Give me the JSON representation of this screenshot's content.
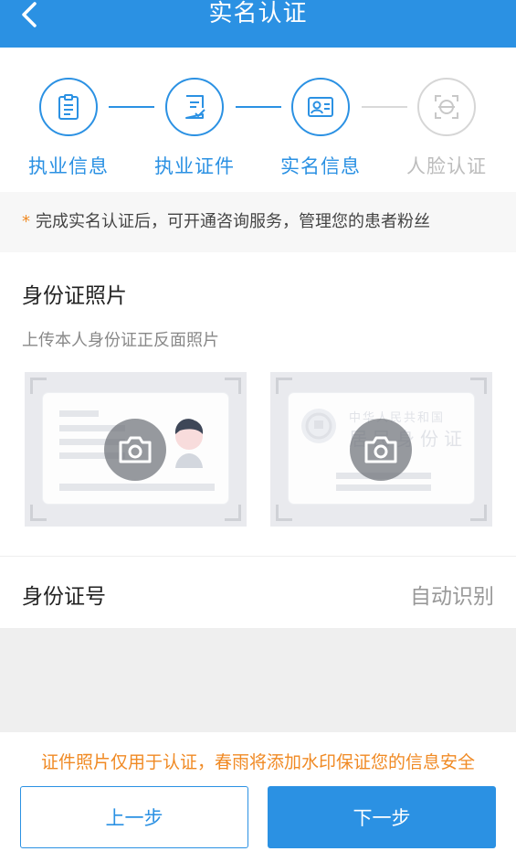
{
  "header": {
    "title": "实名认证",
    "back_icon": "chevron-left-icon"
  },
  "steps": [
    {
      "label": "执业信息",
      "icon": "clipboard-icon",
      "active": true
    },
    {
      "label": "执业证件",
      "icon": "document-check-icon",
      "active": true
    },
    {
      "label": "实名信息",
      "icon": "id-card-icon",
      "active": true
    },
    {
      "label": "人脸认证",
      "icon": "face-scan-icon",
      "active": false
    }
  ],
  "notice": {
    "star": "*",
    "text": "完成实名认证后，可开通咨询服务，管理您的患者粉丝"
  },
  "photo_section": {
    "title": "身份证照片",
    "subtitle": "上传本人身份证正反面照片",
    "back_card_text_line1": "中华人民共和国",
    "back_card_text_line2": "居民身份证"
  },
  "id_number": {
    "label": "身份证号",
    "value": "自动识别"
  },
  "footer": {
    "note": "证件照片仅用于认证，春雨将添加水印保证您的信息安全",
    "prev_label": "上一步",
    "next_label": "下一步"
  },
  "colors": {
    "primary": "#2b91e3",
    "accent": "#f08a24",
    "inactive": "#bdbdbd"
  }
}
